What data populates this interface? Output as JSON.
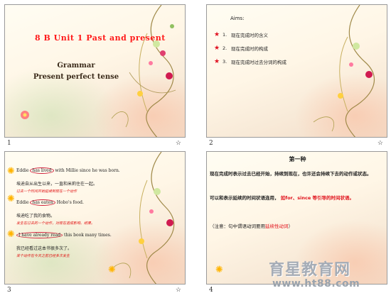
{
  "slides": [
    {
      "number": "1",
      "title": "8 B Unit 1 Past and present",
      "subtitle_line1": "Grammar",
      "subtitle_line2": "Present  perfect tense"
    },
    {
      "number": "2",
      "aims_label": "Aims:",
      "items": [
        {
          "n": "1.",
          "text": "现在完成时的含义"
        },
        {
          "n": "2.",
          "text": "现在完成时的构成"
        },
        {
          "n": "3.",
          "text": "现在完成时过去分词的构成"
        }
      ]
    },
    {
      "number": "3",
      "examples": [
        {
          "before": "Eddie ",
          "marked": "has lived",
          "after": " with Millie since he was born.",
          "cn": "埃迪自从出生以来，一直和米莉住在一起。",
          "note": "过去一个时间开始延续到现在一个动作"
        },
        {
          "before": "Eddie ",
          "marked": "has eaten",
          "after": " Hobo's food.",
          "cn": "埃迪吃了我的食物。",
          "note": "发生在过去的一个动作，对现在造成影响、结果。"
        },
        {
          "before": "",
          "marked": "I have already read",
          "after": " this book many times.",
          "cn": "我已经看过这本书很多次了。",
          "note": "某个动作在今天之前已经多次发生"
        }
      ]
    },
    {
      "number": "4",
      "heading": "第一种",
      "para1": "现在完成时表示过去已经开始，持续到现在，也许还会持续下去的动作或状态。",
      "para2_black": "可以和表示延续的时间状语连用，",
      "para2_red": " 如for、since 等引导的时间状语。",
      "note_black": "（注意：句中谓语动词要用",
      "note_red": "延续性动词",
      "note_end": "）"
    }
  ],
  "anim_icon_label": "",
  "watermark": {
    "title": "育星教育网",
    "url": "www.ht88.com"
  }
}
